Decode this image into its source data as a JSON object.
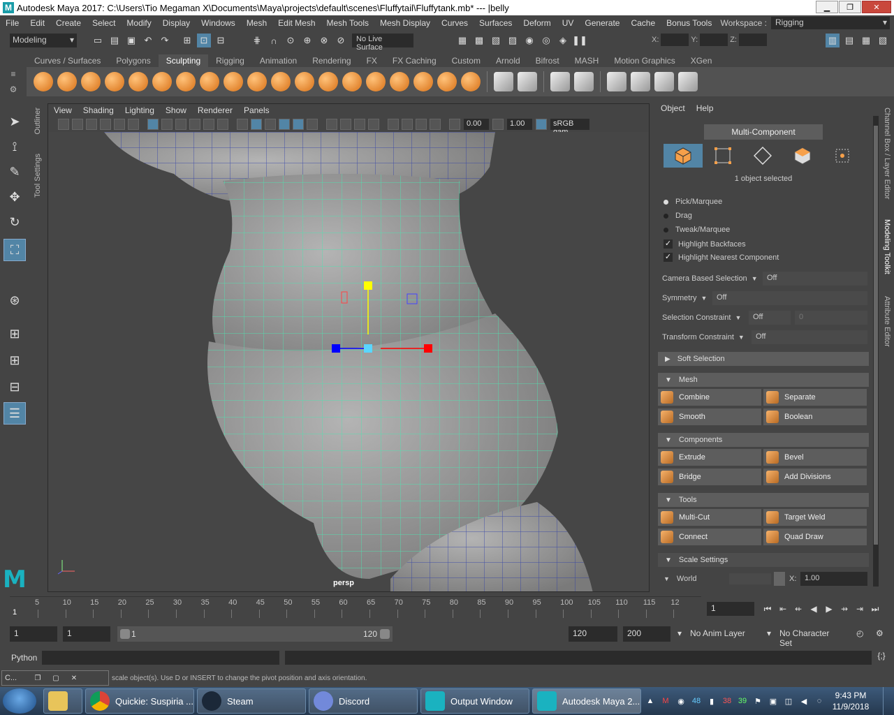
{
  "window": {
    "title": "Autodesk Maya 2017: C:\\Users\\Tio Megaman X\\Documents\\Maya\\projects\\default\\scenes\\Fluffytail\\Fluffytank.mb*   ---   |belly",
    "app_icon": "M"
  },
  "menubar": [
    "File",
    "Edit",
    "Create",
    "Select",
    "Modify",
    "Display",
    "Windows",
    "Mesh",
    "Edit Mesh",
    "Mesh Tools",
    "Mesh Display",
    "Curves",
    "Surfaces",
    "Deform",
    "UV",
    "Generate",
    "Cache",
    "Bonus Tools"
  ],
  "workspace": {
    "label": "Workspace :",
    "value": "Rigging"
  },
  "statusline": {
    "mode": "Modeling",
    "live_surface": "No Live Surface",
    "x_label": "X:",
    "y_label": "Y:",
    "z_label": "Z:"
  },
  "shelf": {
    "tabs": [
      "Curves / Surfaces",
      "Polygons",
      "Sculpting",
      "Rigging",
      "Animation",
      "Rendering",
      "FX",
      "FX Caching",
      "Custom",
      "Arnold",
      "Bifrost",
      "MASH",
      "Motion Graphics",
      "XGen"
    ],
    "active_tab": "Sculpting"
  },
  "side_tabs": {
    "outliner": "Outliner",
    "tool_settings": "Tool Settings",
    "channel_box": "Channel Box / Layer Editor",
    "modeling_toolkit": "Modeling Toolkit",
    "attribute_editor": "Attribute Editor"
  },
  "viewport": {
    "menu": [
      "View",
      "Shading",
      "Lighting",
      "Show",
      "Renderer",
      "Panels"
    ],
    "field1": "0.00",
    "field2": "1.00",
    "colorspace": "sRGB gam",
    "camera": "persp"
  },
  "toolkit": {
    "menu": [
      "Object",
      "Help"
    ],
    "title": "Multi-Component",
    "selected_count": "1 object selected",
    "radios": [
      {
        "label": "Pick/Marquee",
        "on": true
      },
      {
        "label": "Drag",
        "on": false
      },
      {
        "label": "Tweak/Marquee",
        "on": false
      }
    ],
    "checks": [
      "Highlight Backfaces",
      "Highlight Nearest Component"
    ],
    "props": [
      {
        "label": "Camera Based Selection",
        "value": "Off"
      },
      {
        "label": "Symmetry",
        "value": "Off"
      },
      {
        "label": "Selection Constraint",
        "value": "Off",
        "extra": "0"
      },
      {
        "label": "Transform Constraint",
        "value": "Off"
      }
    ],
    "soft_selection": "Soft Selection",
    "mesh_section": "Mesh",
    "mesh_buttons": [
      "Combine",
      "Separate",
      "Smooth",
      "Boolean"
    ],
    "components_section": "Components",
    "component_buttons": [
      "Extrude",
      "Bevel",
      "Bridge",
      "Add Divisions"
    ],
    "tools_section": "Tools",
    "tool_buttons": [
      "Multi-Cut",
      "Target Weld",
      "Connect",
      "Quad Draw"
    ],
    "scale_section": "Scale Settings",
    "world_label": "World",
    "x_label": "X:",
    "x_value": "1.00"
  },
  "timeline": {
    "ticks": [
      "5",
      "10",
      "15",
      "20",
      "25",
      "30",
      "35",
      "40",
      "45",
      "50",
      "55",
      "60",
      "65",
      "70",
      "75",
      "80",
      "85",
      "90",
      "95",
      "100",
      "105",
      "110",
      "115",
      "12"
    ],
    "start_marker": "1",
    "current_frame": "1"
  },
  "range": {
    "start": "1",
    "anim_start": "1",
    "slider_start": "1",
    "slider_end": "120",
    "anim_end": "120",
    "end": "200",
    "anim_layer": "No Anim Layer",
    "character_set": "No Character Set"
  },
  "cmdline": {
    "label": "Python"
  },
  "helpline": {
    "text": "scale object(s). Use D or INSERT to change the pivot position and axis orientation.",
    "minimized_title": "C..."
  },
  "taskbar": {
    "tasks": [
      {
        "label": "Quickie: Suspiria ..."
      },
      {
        "label": "Steam"
      },
      {
        "label": "Discord"
      },
      {
        "label": "Output Window"
      },
      {
        "label": "Autodesk Maya 2..."
      }
    ],
    "tray_numbers": [
      "48",
      "38",
      "39"
    ],
    "time": "9:43 PM",
    "date": "11/9/2018"
  }
}
